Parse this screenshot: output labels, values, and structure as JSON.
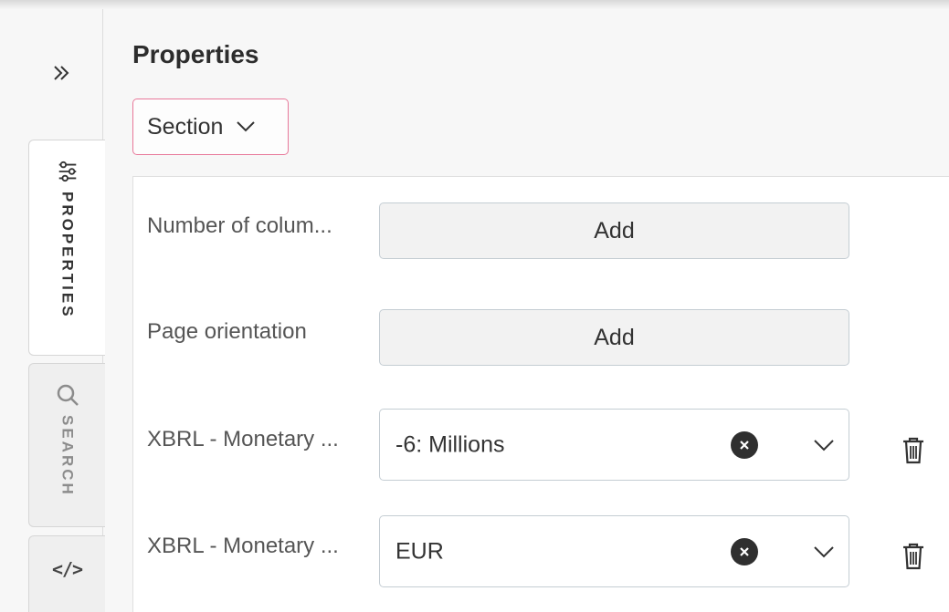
{
  "rail": {
    "tabs": [
      {
        "label": "PROPERTIES",
        "icon": "sliders-icon",
        "active": true
      },
      {
        "label": "SEARCH",
        "icon": "search-icon",
        "active": false
      },
      {
        "label": "</>",
        "icon": "code-icon",
        "active": false
      }
    ]
  },
  "main": {
    "title": "Properties",
    "section_select": {
      "value": "Section"
    },
    "rows": [
      {
        "label": "Number of colum...",
        "control": "button",
        "button_label": "Add"
      },
      {
        "label": "Page orientation",
        "control": "button",
        "button_label": "Add"
      },
      {
        "label": "XBRL - Monetary ...",
        "control": "select",
        "value": "-6: Millions"
      },
      {
        "label": "XBRL - Monetary ...",
        "control": "select",
        "value": "EUR"
      }
    ]
  },
  "colors": {
    "accent_border": "#e8789a",
    "dark_icon": "#2f2f2f"
  }
}
